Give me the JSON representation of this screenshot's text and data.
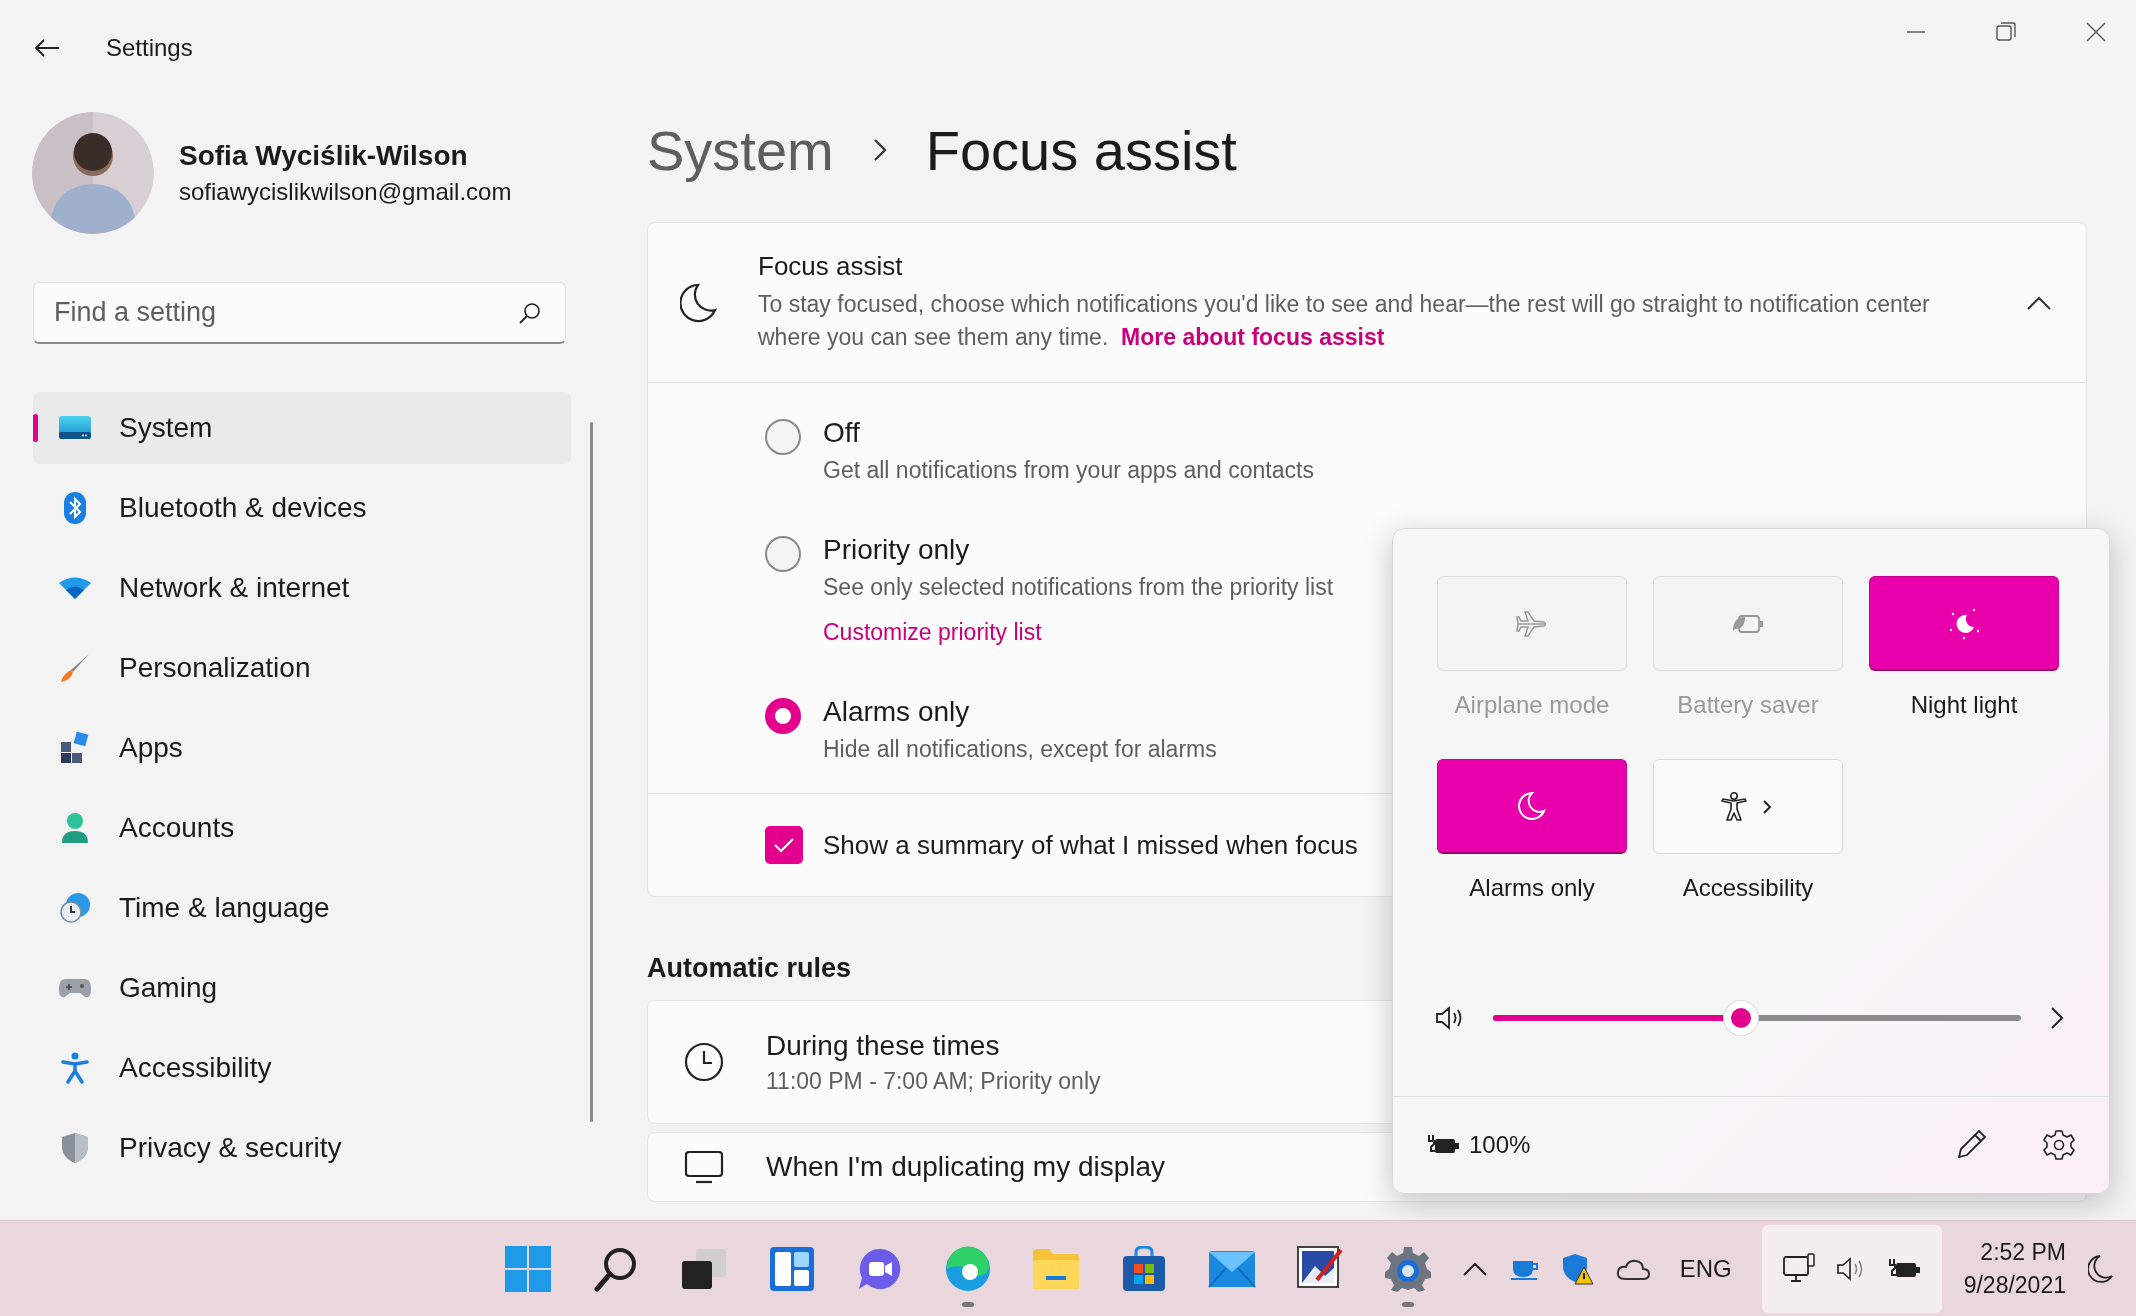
{
  "window": {
    "title": "Settings"
  },
  "user": {
    "name": "Sofia Wyciślik-Wilson",
    "email": "sofiawycislikwilson@gmail.com"
  },
  "search": {
    "placeholder": "Find a setting"
  },
  "nav": [
    {
      "label": "System",
      "selected": true
    },
    {
      "label": "Bluetooth & devices",
      "selected": false
    },
    {
      "label": "Network & internet",
      "selected": false
    },
    {
      "label": "Personalization",
      "selected": false
    },
    {
      "label": "Apps",
      "selected": false
    },
    {
      "label": "Accounts",
      "selected": false
    },
    {
      "label": "Time & language",
      "selected": false
    },
    {
      "label": "Gaming",
      "selected": false
    },
    {
      "label": "Accessibility",
      "selected": false
    },
    {
      "label": "Privacy & security",
      "selected": false
    }
  ],
  "breadcrumb": {
    "parent": "System",
    "current": "Focus assist"
  },
  "focus_card": {
    "title": "Focus assist",
    "description": "To stay focused, choose which notifications you'd like to see and hear—the rest will go straight to notification center where you can see them any time.",
    "link": "More about focus assist",
    "expanded": true,
    "options": [
      {
        "label": "Off",
        "description": "Get all notifications from your apps and contacts",
        "selected": false
      },
      {
        "label": "Priority only",
        "description": "See only selected notifications from the priority list",
        "link": "Customize priority list",
        "selected": false
      },
      {
        "label": "Alarms only",
        "description": "Hide all notifications, except for alarms",
        "selected": true
      }
    ],
    "summary": {
      "label": "Show a summary of what I missed when focus",
      "checked": true
    }
  },
  "automatic_rules": {
    "heading": "Automatic rules",
    "rules": [
      {
        "title": "During these times",
        "subtitle": "11:00 PM - 7:00 AM; Priority only"
      },
      {
        "title": "When I'm duplicating my display"
      }
    ]
  },
  "quick_settings": {
    "tiles": [
      {
        "label": "Airplane mode",
        "on": false,
        "disabled": true
      },
      {
        "label": "Battery saver",
        "on": false,
        "disabled": true
      },
      {
        "label": "Night light",
        "on": true,
        "disabled": false
      },
      {
        "label": "Alarms only",
        "on": true,
        "disabled": false
      },
      {
        "label": "Accessibility",
        "on": false,
        "disabled": false
      }
    ],
    "volume": {
      "level": 0.47
    },
    "battery": "100%"
  },
  "taskbar": {
    "apps": [
      {
        "running": false
      },
      {
        "running": false
      },
      {
        "running": false
      },
      {
        "running": false
      },
      {
        "running": false
      },
      {
        "running": true
      },
      {
        "running": false
      },
      {
        "running": false
      },
      {
        "running": false
      },
      {
        "running": false
      },
      {
        "running": true
      }
    ],
    "language": "ENG",
    "time": "2:52 PM",
    "date": "9/28/2021"
  }
}
